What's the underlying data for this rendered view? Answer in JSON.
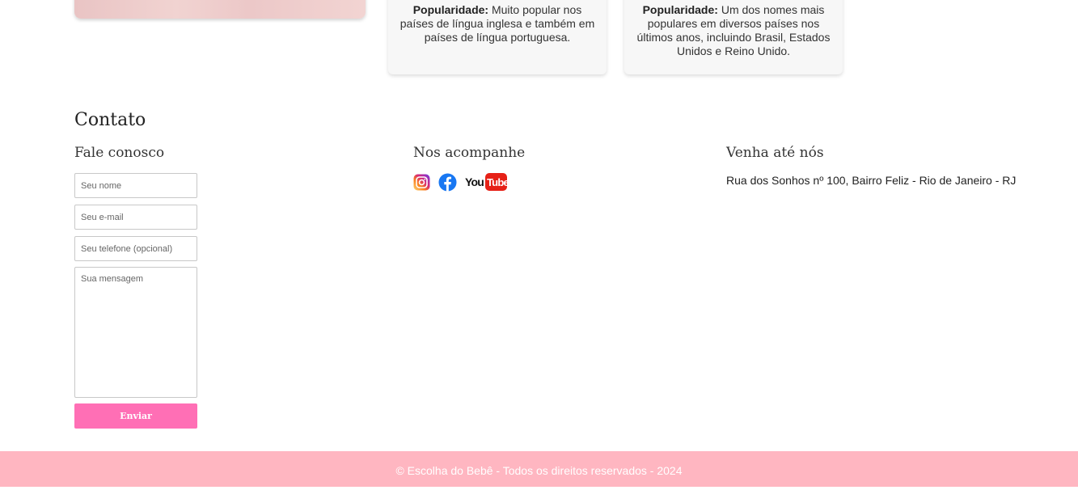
{
  "cards": [
    {
      "label": "Popularidade:",
      "text": " Muito popular nos países de língua inglesa e também em países de língua portuguesa."
    },
    {
      "label": "Popularidade:",
      "text": " Um dos nomes mais populares em diversos países nos últimos anos, incluindo Brasil, Estados Unidos e Reino Unido."
    }
  ],
  "contact": {
    "title": "Contato",
    "form": {
      "heading": "Fale conosco",
      "name_placeholder": "Seu nome",
      "email_placeholder": "Seu e-mail",
      "phone_placeholder": "Seu telefone (opcional)",
      "message_placeholder": "Sua mensagem",
      "submit_label": "Enviar"
    },
    "social": {
      "heading": "Nos acompanhe",
      "icons": [
        "instagram-icon",
        "facebook-icon",
        "youtube-icon"
      ],
      "youtube_you": "You",
      "youtube_tube": "Tube"
    },
    "location": {
      "heading": "Venha até nós",
      "address": "Rua dos Sonhos nº 100, Bairro Feliz - Rio de Janeiro - RJ"
    }
  },
  "footer": {
    "text": "© Escolha do Bebê - Todos os direitos reservados - 2024"
  },
  "colors": {
    "button": "#ff6fb5",
    "footer": "#ffb6c1",
    "card_bg": "#f7f7f7"
  }
}
